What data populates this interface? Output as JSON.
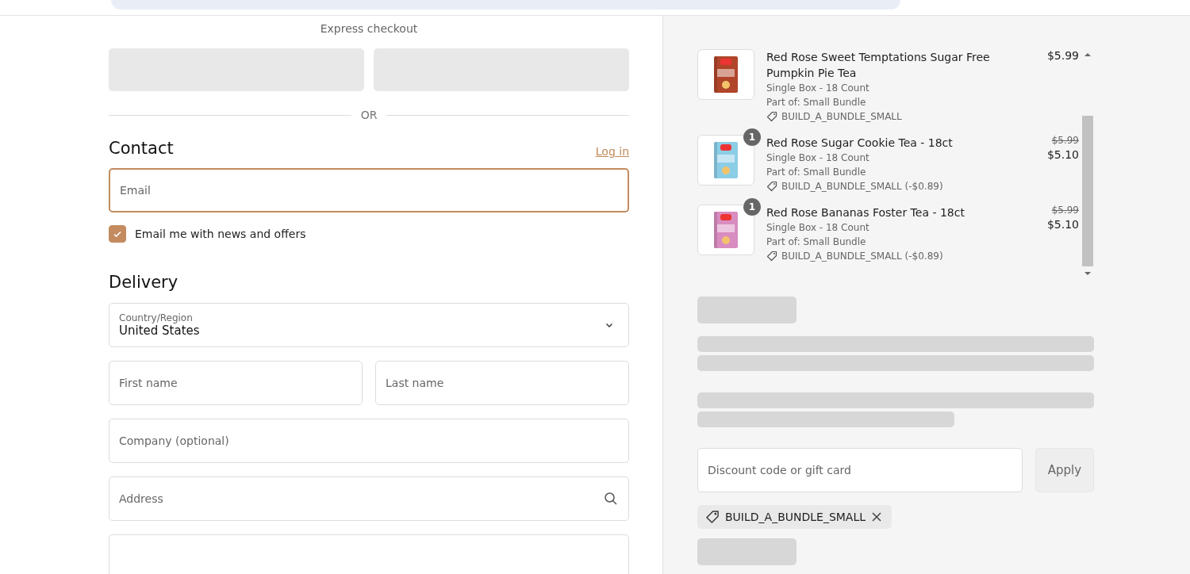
{
  "express_checkout": {
    "label": "Express checkout",
    "divider": "OR"
  },
  "contact": {
    "heading": "Contact",
    "login_link": "Log in",
    "email": {
      "placeholder": "Email"
    },
    "newsletter": {
      "label": "Email me with news and offers",
      "checked": true
    }
  },
  "delivery": {
    "heading": "Delivery",
    "country": {
      "label": "Country/Region",
      "value": "United States"
    },
    "name_fields": [
      {
        "placeholder": "First name"
      },
      {
        "placeholder": "Last name"
      }
    ],
    "company": {
      "placeholder": "Company (optional)"
    },
    "address": {
      "placeholder": "Address"
    }
  },
  "cart": {
    "items": [
      {
        "title": "Red Rose Sweet Temptations Sugar Free Pumpkin Pie Tea",
        "variant": "Single Box - 18 Count",
        "bundle": "Part of: Small Bundle",
        "discount": "BUILD_A_BUNDLE_SMALL",
        "price": "$5.99",
        "color": "#b0452a"
      },
      {
        "title": "Red Rose Sugar Cookie Tea - 18ct",
        "quantity": "1",
        "variant": "Single Box - 18 Count",
        "bundle": "Part of: Small Bundle",
        "discount": "BUILD_A_BUNDLE_SMALL (-$0.89)",
        "original_price": "$5.99",
        "price": "$5.10",
        "color": "#8ccde6"
      },
      {
        "title": "Red Rose Bananas Foster Tea - 18ct",
        "quantity": "1",
        "variant": "Single Box - 18 Count",
        "bundle": "Part of: Small Bundle",
        "discount": "BUILD_A_BUNDLE_SMALL (-$0.89)",
        "original_price": "$5.99",
        "price": "$5.10",
        "color": "#d98cc0"
      }
    ]
  },
  "discount": {
    "placeholder": "Discount code or gift card",
    "apply": "Apply",
    "applied_code": "BUILD_A_BUNDLE_SMALL"
  }
}
